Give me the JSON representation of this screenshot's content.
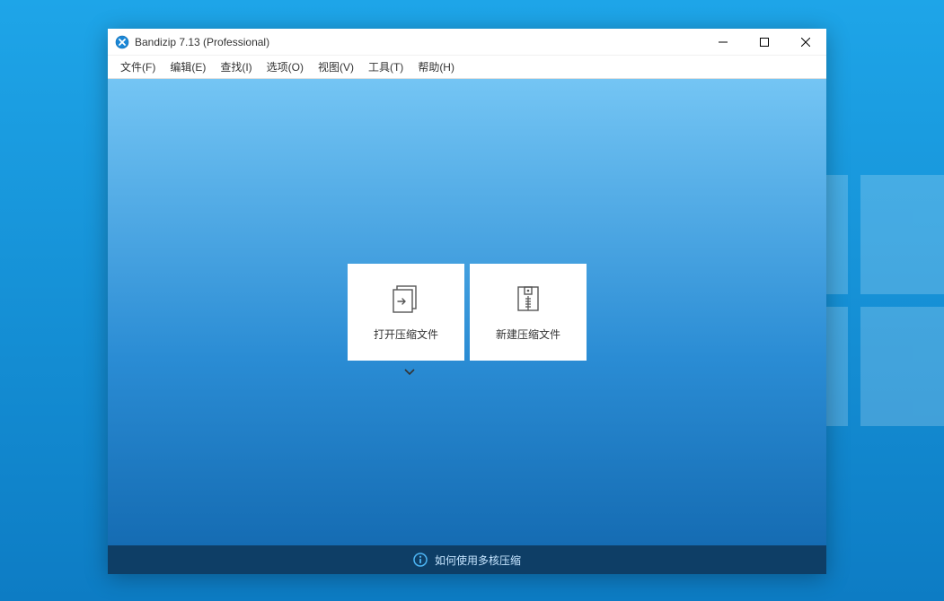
{
  "window": {
    "title": "Bandizip 7.13 (Professional)"
  },
  "menubar": {
    "items": [
      "文件(F)",
      "编辑(E)",
      "查找(I)",
      "选项(O)",
      "视图(V)",
      "工具(T)",
      "帮助(H)"
    ]
  },
  "cards": {
    "open": {
      "label": "打开压缩文件"
    },
    "new": {
      "label": "新建压缩文件"
    }
  },
  "statusbar": {
    "text": "如何使用多核压缩"
  }
}
